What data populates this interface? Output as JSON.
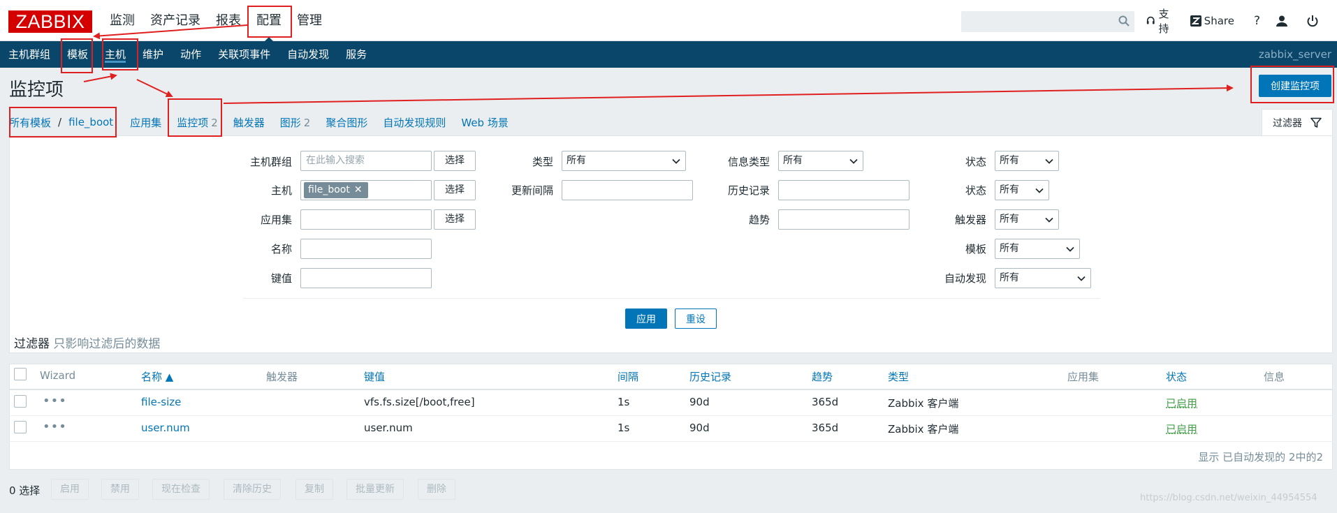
{
  "header": {
    "logo": "ZABBIX",
    "main_menu": [
      "监测",
      "资产记录",
      "报表",
      "配置",
      "管理"
    ],
    "active_menu": "配置",
    "search_placeholder": "",
    "tools": {
      "support": "支持",
      "share": "Share",
      "help": "?"
    }
  },
  "submenu": {
    "items": [
      "主机群组",
      "模板",
      "主机",
      "维护",
      "动作",
      "关联项事件",
      "自动发现",
      "服务"
    ],
    "active": "主机",
    "server_name": "zabbix_server"
  },
  "page": {
    "title": "监控项",
    "create_button": "创建监控项"
  },
  "nav": {
    "crumb_all": "所有模板",
    "crumb_sep": "/",
    "crumb_host": "file_boot",
    "tabs": [
      {
        "label": "应用集",
        "count": ""
      },
      {
        "label": "监控项",
        "count": "2"
      },
      {
        "label": "触发器",
        "count": ""
      },
      {
        "label": "图形",
        "count": "2"
      },
      {
        "label": "聚合图形",
        "count": ""
      },
      {
        "label": "自动发现规则",
        "count": ""
      },
      {
        "label": "Web 场景",
        "count": ""
      }
    ],
    "filter_tab": "过滤器"
  },
  "filter": {
    "hostgroup_label": "主机群组",
    "hostgroup_placeholder": "在此输入搜索",
    "select_label": "选择",
    "host_label": "主机",
    "host_tag": "file_boot",
    "app_label": "应用集",
    "name_label": "名称",
    "key_label": "键值",
    "type_label": "类型",
    "type_value": "所有",
    "interval_label": "更新间隔",
    "info_type_label": "信息类型",
    "info_type_value": "所有",
    "history_label": "历史记录",
    "trends_label": "趋势",
    "state_label": "状态",
    "state_value": "所有",
    "status_label": "状态",
    "status_value": "所有",
    "triggers_label": "触发器",
    "triggers_value": "所有",
    "template_label": "模板",
    "template_value": "所有",
    "discovered_label": "自动发现",
    "discovered_value": "所有",
    "apply": "应用",
    "reset": "重设",
    "note_main": "过滤器",
    "note_muted": "只影响过滤后的数据"
  },
  "table": {
    "headers": {
      "wizard": "Wizard",
      "name": "名称 ▲",
      "triggers": "触发器",
      "key": "键值",
      "interval": "间隔",
      "history": "历史记录",
      "trends": "趋势",
      "type": "类型",
      "applications": "应用集",
      "status": "状态",
      "info": "信息"
    },
    "rows": [
      {
        "wizard": "•••",
        "name": "file-size",
        "key": "vfs.fs.size[/boot,free]",
        "interval": "1s",
        "history": "90d",
        "trends": "365d",
        "type": "Zabbix 客户端",
        "status": "已启用"
      },
      {
        "wizard": "•••",
        "name": "user.num",
        "key": "user.num",
        "interval": "1s",
        "history": "90d",
        "trends": "365d",
        "type": "Zabbix 客户端",
        "status": "已启用"
      }
    ],
    "footer": "显示 已自动发现的 2中的2"
  },
  "actions": {
    "selected": "0 选择",
    "buttons": [
      "启用",
      "禁用",
      "现在检查",
      "清除历史",
      "复制",
      "批量更新",
      "删除"
    ]
  },
  "watermark": "https://blog.csdn.net/weixin_44954554",
  "colors": {
    "brand": "#d40000",
    "nav": "#0a466a",
    "link": "#0275b8",
    "enabled": "#429e47",
    "annotation": "#e02020"
  }
}
